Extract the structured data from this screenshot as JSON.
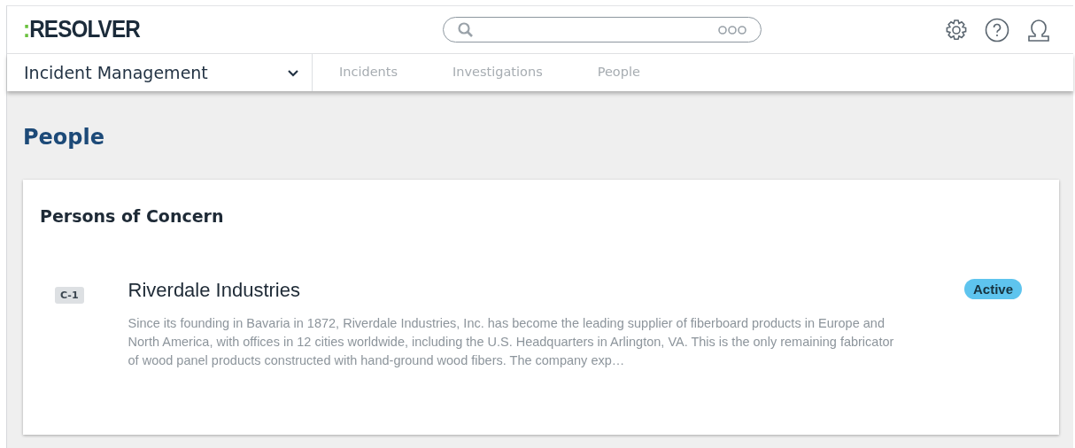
{
  "header": {
    "logo": {
      "mark": ":",
      "word": "RESOLVER"
    }
  },
  "nav": {
    "app_switcher": "Incident Management",
    "tabs": [
      {
        "label": "Incidents",
        "selected": false
      },
      {
        "label": "Investigations",
        "selected": false
      },
      {
        "label": "People",
        "selected": false
      }
    ]
  },
  "page_title": "People",
  "card": {
    "title": "Persons of Concern",
    "items": [
      {
        "id": "C-1",
        "name": "Riverdale Industries",
        "status": "Active",
        "description": "Since its founding in Bavaria in 1872, Riverdale Industries, Inc. has become the leading supplier of fiberboard products in Europe and North America, with offices in 12 cities worldwide, including the U.S. Headquarters in Arlington, VA. This is the only remaining fabricator of wood panel products constructed with hand-ground wood fibers. The company exp…"
      }
    ]
  }
}
